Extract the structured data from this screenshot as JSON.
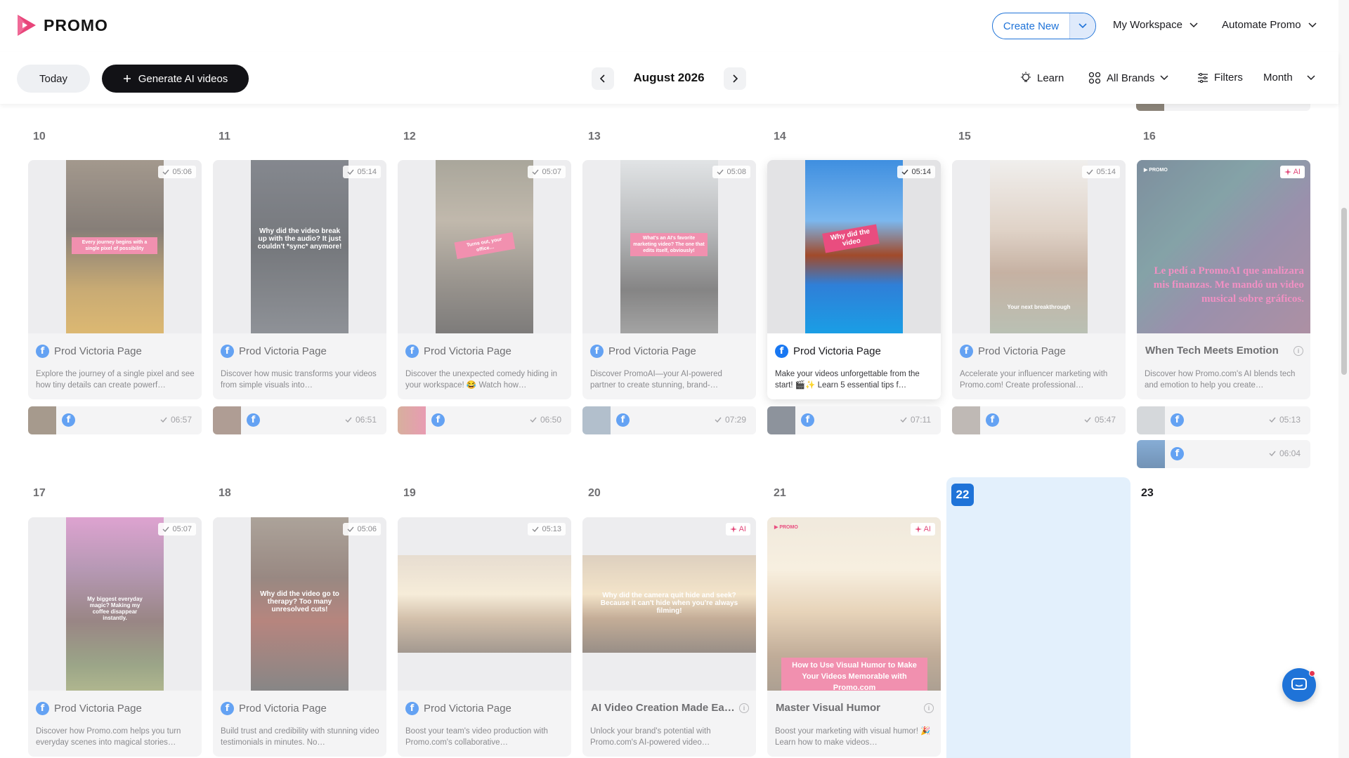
{
  "app": {
    "logo_text": "PROMO"
  },
  "header": {
    "create_new": "Create New",
    "workspace": "My Workspace",
    "automate": "Automate Promo"
  },
  "toolbar": {
    "today": "Today",
    "generate": "Generate AI videos",
    "month_title": "August 2026",
    "learn": "Learn",
    "brands": "All Brands",
    "filters": "Filters",
    "view": "Month"
  },
  "days": {
    "d10": "10",
    "d11": "11",
    "d12": "12",
    "d13": "13",
    "d14": "14",
    "d15": "15",
    "d16": "16",
    "d17": "17",
    "d18": "18",
    "d19": "19",
    "d20": "20",
    "d21": "21",
    "d22": "22",
    "d23": "23"
  },
  "week1": [
    {
      "page": "Prod Victoria Page",
      "duration": "05:06",
      "overlay": "Every journey begins with a single pixel of possibility",
      "desc": "Explore the journey of a single pixel and see how tiny details can create powerf…"
    },
    {
      "page": "Prod Victoria Page",
      "duration": "05:14",
      "overlay": "Why did the video break up with the audio? It just couldn't *sync* anymore!",
      "desc": "Discover how music transforms your videos from simple visuals into…"
    },
    {
      "page": "Prod Victoria Page",
      "duration": "05:07",
      "overlay": "Turns out, your office…",
      "desc": "Discover the unexpected comedy hiding in your workspace! 😂 Watch how…"
    },
    {
      "page": "Prod Victoria Page",
      "duration": "05:08",
      "overlay": "What's an AI's favorite marketing video? The one that edits itself, obviously!",
      "desc": "Discover PromoAI—your AI-powered partner to create stunning, brand-…"
    },
    {
      "page": "Prod Victoria Page",
      "duration": "05:14",
      "overlay": "Why did the video",
      "desc": "Make your videos unforgettable from the start! 🎬✨ Learn 5 essential tips f…"
    },
    {
      "page": "Prod Victoria Page",
      "duration": "05:14",
      "overlay": "Your next breakthrough",
      "desc": "Accelerate your influencer marketing with Promo.com! Create professional…"
    },
    {
      "title": "When Tech Meets Emotion",
      "badge": "AI",
      "overlay": "Le pedí a PromoAI que analizara mis finanzas. Me mandó un video musical sobre gráficos.",
      "desc": "Discover how Promo.com's AI blends tech and emotion to help you create…"
    }
  ],
  "week1_minis": [
    {
      "duration": "06:57"
    },
    {
      "duration": "06:51"
    },
    {
      "duration": "06:50"
    },
    {
      "duration": "07:29"
    },
    {
      "duration": "07:11"
    },
    {
      "duration": "05:47"
    },
    {
      "duration": "05:13"
    },
    {
      "duration": "06:04"
    }
  ],
  "week2": [
    {
      "page": "Prod Victoria Page",
      "duration": "05:07",
      "overlay": "My biggest everyday magic? Making my coffee disappear instantly.",
      "desc": "Discover how Promo.com helps you turn everyday scenes into magical stories…"
    },
    {
      "page": "Prod Victoria Page",
      "duration": "05:06",
      "overlay": "Why did the video go to therapy? Too many unresolved cuts!",
      "desc": "Build trust and credibility with stunning video testimonials in minutes. No…"
    },
    {
      "page": "Prod Victoria Page",
      "duration": "05:13",
      "overlay": "",
      "desc": "Boost your team's video production with Promo.com's collaborative…"
    },
    {
      "title": "AI Video Creation Made Ea…",
      "badge": "AI",
      "overlay": "Why did the camera quit hide and seek? Because it can't hide when you're always filming!",
      "desc": "Unlock your brand's potential with Promo.com's AI-powered video…"
    },
    {
      "title": "Master Visual Humor",
      "badge": "AI",
      "overlay": "How to Use Visual Humor to Make Your Videos Memorable with Promo.com",
      "desc": "Boost your marketing with visual humor! 🎉 Learn how to make videos…"
    }
  ],
  "colors": {
    "accent": "#1f73d8",
    "brand_pink": "#e94d7f",
    "today_bg": "#e3f0fc",
    "facebook": "#1877f2"
  }
}
